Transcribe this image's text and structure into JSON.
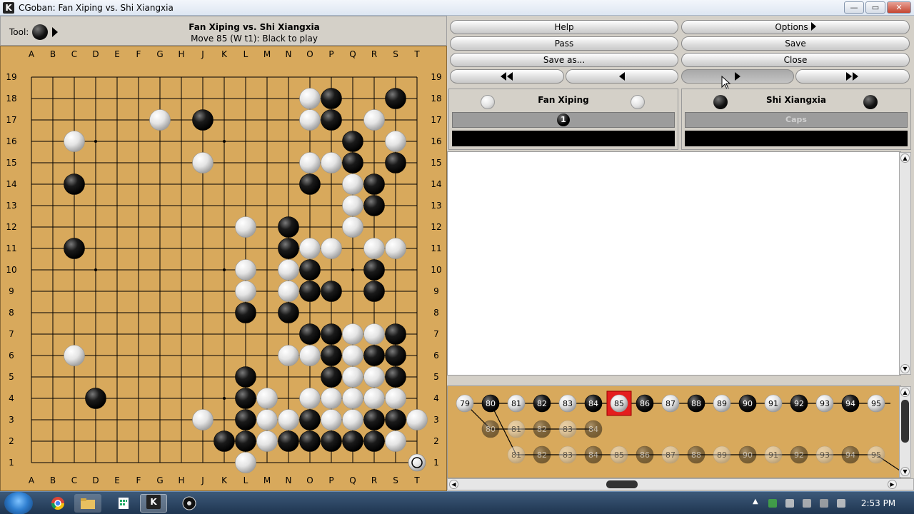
{
  "window": {
    "title": "CGoban: Fan Xiping vs. Shi Xiangxia",
    "app_icon_letter": "K",
    "minimize_glyph": "—",
    "maximize_glyph": "▭",
    "close_glyph": "✕"
  },
  "header": {
    "tool_label": "Tool:",
    "title": "Fan Xiping vs. Shi Xiangxia",
    "status": "Move 85 (W t1): Black to play"
  },
  "board": {
    "size": 19,
    "columns": [
      "A",
      "B",
      "C",
      "D",
      "E",
      "F",
      "G",
      "H",
      "J",
      "K",
      "L",
      "M",
      "N",
      "O",
      "P",
      "Q",
      "R",
      "S",
      "T"
    ],
    "rows": [
      "19",
      "18",
      "17",
      "16",
      "15",
      "14",
      "13",
      "12",
      "11",
      "10",
      "9",
      "8",
      "7",
      "6",
      "5",
      "4",
      "3",
      "2",
      "1"
    ],
    "hoshi": [
      "D16",
      "K16",
      "Q16",
      "D10",
      "K10",
      "Q10",
      "D4",
      "K4",
      "Q4"
    ],
    "black": [
      "P18",
      "S18",
      "J17",
      "P17",
      "Q16",
      "Q15",
      "S15",
      "C14",
      "O14",
      "R14",
      "R13",
      "N12",
      "C11",
      "N11",
      "O10",
      "R10",
      "O9",
      "P9",
      "R9",
      "L8",
      "N8",
      "O7",
      "P7",
      "S7",
      "P6",
      "R6",
      "S6",
      "L5",
      "P5",
      "S5",
      "D4",
      "L4",
      "L3",
      "O3",
      "R3",
      "S3",
      "K2",
      "L2",
      "N2",
      "O2",
      "P2",
      "Q2",
      "R2"
    ],
    "white": [
      "O18",
      "G17",
      "O17",
      "R17",
      "C16",
      "S16",
      "J15",
      "O15",
      "P15",
      "Q14",
      "Q13",
      "L12",
      "Q12",
      "O11",
      "P11",
      "R11",
      "S11",
      "L10",
      "N10",
      "L9",
      "N9",
      "Q7",
      "R7",
      "C6",
      "N6",
      "O6",
      "Q6",
      "Q5",
      "R5",
      "M4",
      "O4",
      "P4",
      "Q4",
      "R4",
      "S4",
      "J3",
      "M3",
      "N3",
      "P3",
      "Q3",
      "T3",
      "M2",
      "S2",
      "L1"
    ],
    "last_move_marker": "T1"
  },
  "buttons": {
    "help": "Help",
    "options": "Options",
    "pass": "Pass",
    "save": "Save",
    "save_as": "Save as...",
    "close": "Close"
  },
  "players": {
    "white": {
      "name": "Fan Xiping",
      "bar": "1"
    },
    "black": {
      "name": "Shi Xiangxia",
      "bar": "Caps"
    }
  },
  "tree": {
    "main": [
      {
        "n": "79",
        "c": "w"
      },
      {
        "n": "80",
        "c": "b"
      },
      {
        "n": "81",
        "c": "w"
      },
      {
        "n": "82",
        "c": "b"
      },
      {
        "n": "83",
        "c": "w"
      },
      {
        "n": "84",
        "c": "b"
      },
      {
        "n": "85",
        "c": "w"
      },
      {
        "n": "86",
        "c": "b"
      },
      {
        "n": "87",
        "c": "w"
      },
      {
        "n": "88",
        "c": "b"
      },
      {
        "n": "89",
        "c": "w"
      },
      {
        "n": "90",
        "c": "b"
      },
      {
        "n": "91",
        "c": "w"
      },
      {
        "n": "92",
        "c": "b"
      },
      {
        "n": "93",
        "c": "w"
      },
      {
        "n": "94",
        "c": "b"
      },
      {
        "n": "95",
        "c": "w"
      }
    ],
    "var1": [
      "80",
      "81",
      "82",
      "83",
      "84"
    ],
    "var2": [
      "81",
      "82",
      "83",
      "84",
      "85",
      "86",
      "87",
      "88",
      "89",
      "90",
      "91",
      "92",
      "93",
      "94",
      "95"
    ],
    "current": "85"
  },
  "taskbar": {
    "time": "2:53 PM",
    "k_app": "K"
  }
}
